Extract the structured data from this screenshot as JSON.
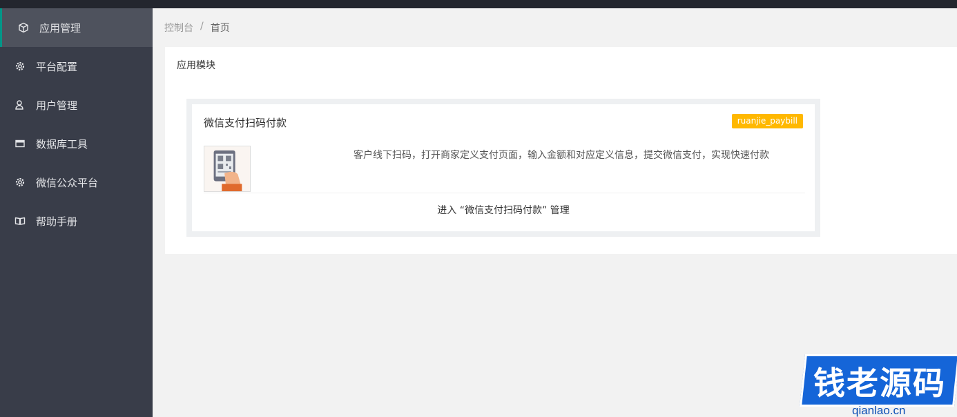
{
  "sidebar": {
    "items": [
      {
        "label": "应用管理",
        "icon": "cube-icon",
        "active": true
      },
      {
        "label": "平台配置",
        "icon": "gear-icon"
      },
      {
        "label": "用户管理",
        "icon": "user-icon"
      },
      {
        "label": "数据库工具",
        "icon": "database-icon"
      },
      {
        "label": "微信公众平台",
        "icon": "gear-icon"
      },
      {
        "label": "帮助手册",
        "icon": "book-icon"
      }
    ]
  },
  "breadcrumb": {
    "root": "控制台",
    "separator": "/",
    "current": "首页"
  },
  "panel": {
    "title": "应用模块"
  },
  "card": {
    "name": "微信支付扫码付款",
    "tag": "ruanjie_paybill",
    "description": "客户线下扫码，打开商家定义支付页面，输入金额和对应定义信息，提交微信支付，实现快速付款",
    "link": "进入 “微信支付扫码付款” 管理"
  },
  "watermark": {
    "text": "钱老源码",
    "sub": "qianlao.cn"
  },
  "colors": {
    "sidebar": "#393d49",
    "accent": "#009688",
    "tag": "#ffb800"
  }
}
